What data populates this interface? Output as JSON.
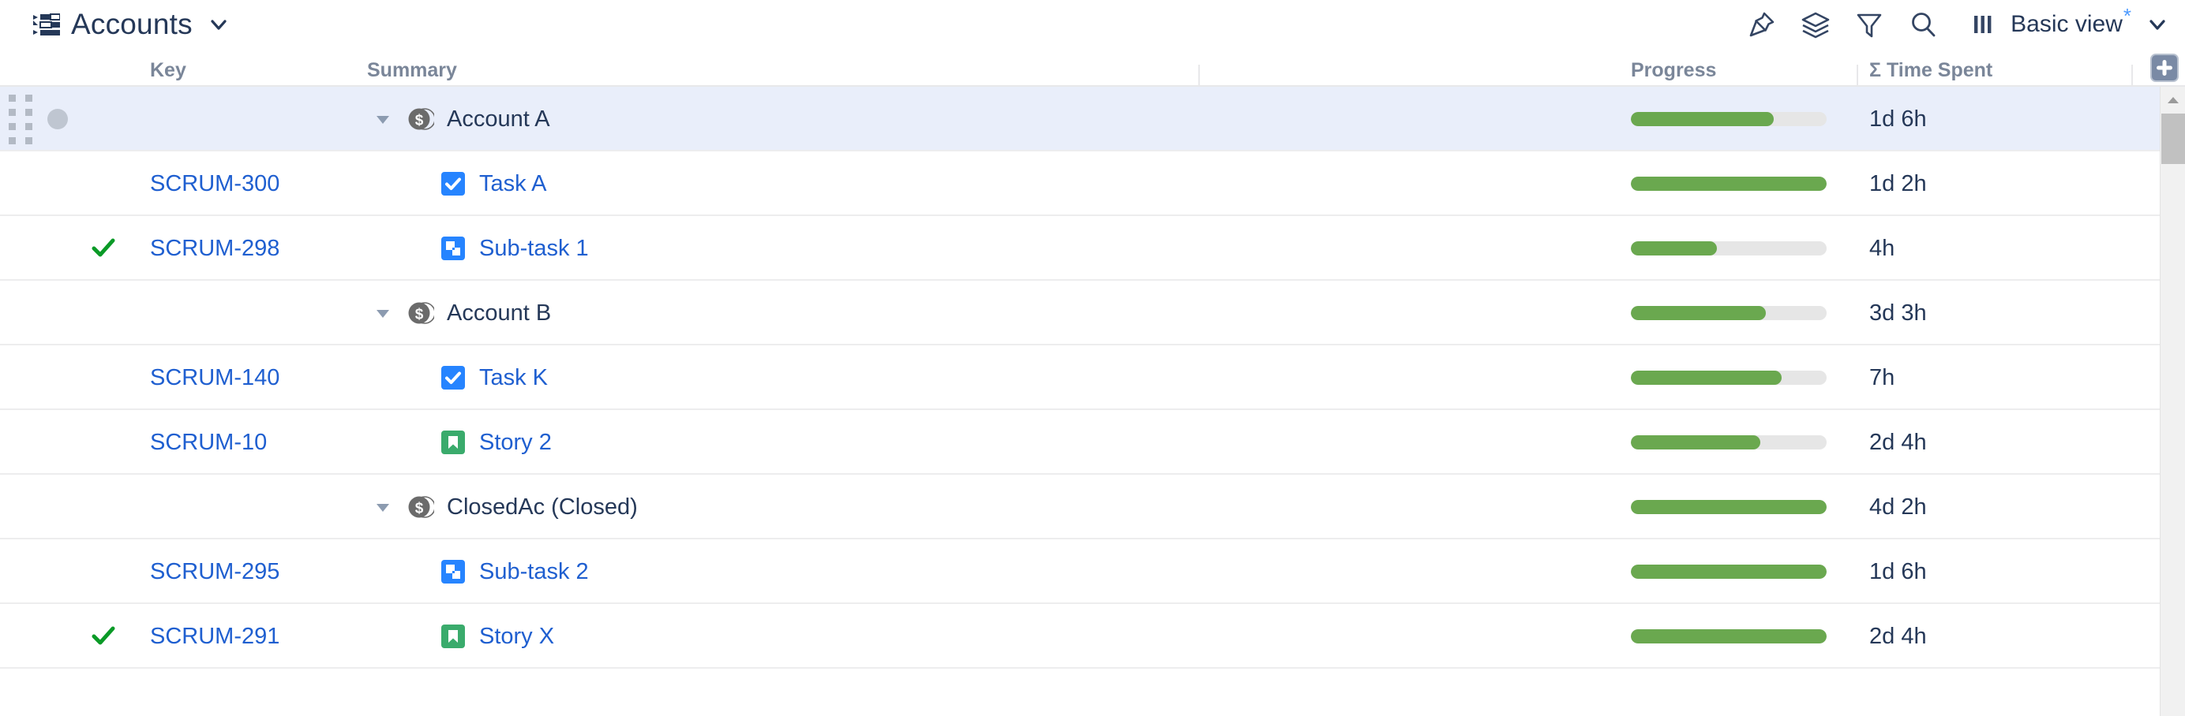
{
  "header": {
    "title": "Accounts",
    "struct_icon": "structure-icon",
    "caret_icon": "chevron-down-icon",
    "toolbar": [
      {
        "name": "pin-icon",
        "label": "Pin"
      },
      {
        "name": "layers-icon",
        "label": "Layers"
      },
      {
        "name": "filter-icon",
        "label": "Filter"
      },
      {
        "name": "search-icon",
        "label": "Search"
      }
    ],
    "view": {
      "columns_icon": "columns-icon",
      "label": "Basic view",
      "modified_marker": "*",
      "caret_icon": "chevron-down-icon"
    }
  },
  "columns": {
    "key": "Key",
    "summary": "Summary",
    "progress": "Progress",
    "time_spent": "Σ Time Spent",
    "add_column_icon": "plus-icon"
  },
  "colors": {
    "selected_row": "#e9eefa",
    "link": "#1f5fd0",
    "text": "#253858",
    "header_text": "#7a8699",
    "progress_fill": "#6aa84f",
    "progress_track": "#e6e6e6",
    "account_icon": "#6b6b6b",
    "task_icon": "#2684ff",
    "subtask_icon": "#2684ff",
    "story_icon": "#3aab6c",
    "done_check": "#0a9a27",
    "accent_star": "#4c9aff",
    "add_button": "#7a8aa5"
  },
  "rows": [
    {
      "key": "",
      "summary": "Account A",
      "type": "account",
      "indent": 0,
      "expanded": true,
      "selected": true,
      "done": false,
      "drag_handle": true,
      "row_dot": true,
      "progress_pct": 73,
      "time_spent": "1d 6h"
    },
    {
      "key": "SCRUM-300",
      "summary": "Task A",
      "type": "task",
      "indent": 1,
      "expanded": false,
      "selected": false,
      "done": false,
      "drag_handle": false,
      "row_dot": false,
      "progress_pct": 100,
      "time_spent": "1d 2h"
    },
    {
      "key": "SCRUM-298",
      "summary": "Sub-task 1",
      "type": "subtask",
      "indent": 1,
      "expanded": false,
      "selected": false,
      "done": true,
      "drag_handle": false,
      "row_dot": false,
      "progress_pct": 44,
      "time_spent": "4h"
    },
    {
      "key": "",
      "summary": "Account B",
      "type": "account",
      "indent": 0,
      "expanded": true,
      "selected": false,
      "done": false,
      "drag_handle": false,
      "row_dot": false,
      "progress_pct": 69,
      "time_spent": "3d 3h"
    },
    {
      "key": "SCRUM-140",
      "summary": "Task K",
      "type": "task",
      "indent": 1,
      "expanded": false,
      "selected": false,
      "done": false,
      "drag_handle": false,
      "row_dot": false,
      "progress_pct": 77,
      "time_spent": "7h"
    },
    {
      "key": "SCRUM-10",
      "summary": "Story 2",
      "type": "story",
      "indent": 1,
      "expanded": false,
      "selected": false,
      "done": false,
      "drag_handle": false,
      "row_dot": false,
      "progress_pct": 66,
      "time_spent": "2d 4h"
    },
    {
      "key": "",
      "summary": "ClosedAc (Closed)",
      "type": "account",
      "indent": 0,
      "expanded": true,
      "selected": false,
      "done": false,
      "drag_handle": false,
      "row_dot": false,
      "progress_pct": 100,
      "time_spent": "4d 2h"
    },
    {
      "key": "SCRUM-295",
      "summary": "Sub-task 2",
      "type": "subtask",
      "indent": 1,
      "expanded": false,
      "selected": false,
      "done": false,
      "drag_handle": false,
      "row_dot": false,
      "progress_pct": 100,
      "time_spent": "1d 6h"
    },
    {
      "key": "SCRUM-291",
      "summary": "Story X",
      "type": "story",
      "indent": 1,
      "expanded": false,
      "selected": false,
      "done": true,
      "drag_handle": false,
      "row_dot": false,
      "progress_pct": 100,
      "time_spent": "2d 4h"
    }
  ],
  "scrollbar": {
    "up_icon": "triangle-up-icon",
    "thumb": "scroll-thumb"
  }
}
